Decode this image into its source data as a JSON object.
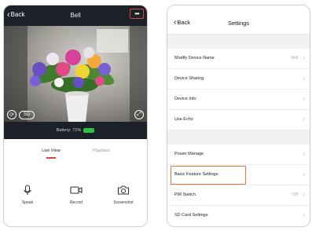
{
  "left_screen": {
    "back_label": "Back",
    "title": "Bell",
    "more_label": "•••",
    "sd_label": "SD",
    "battery_label": "Battery: 71%",
    "tabs": [
      {
        "label": "Live View"
      },
      {
        "label": "Playback"
      }
    ],
    "actions": [
      {
        "label": "Speak",
        "icon": "microphone-icon"
      },
      {
        "label": "Record",
        "icon": "video-camera-icon"
      },
      {
        "label": "Screenshot",
        "icon": "camera-icon"
      }
    ],
    "battery_level": 0.71,
    "colors": {
      "header_bg": "#1c2029",
      "accent": "#d9452f",
      "battery": "#2ec24a"
    }
  },
  "right_screen": {
    "back_label": "Back",
    "title": "Settings",
    "groups": [
      {
        "items": [
          {
            "label": "Modify Device Name",
            "value": "Bell"
          },
          {
            "label": "Device Sharing",
            "value": ""
          },
          {
            "label": "Device Info",
            "value": ""
          },
          {
            "label": "Use Echo",
            "value": ""
          }
        ]
      },
      {
        "items": [
          {
            "label": "Power Manage",
            "value": ""
          },
          {
            "label": "Basic Feature Settings",
            "value": "",
            "highlighted": true
          },
          {
            "label": "PIR Switch",
            "value": "Off"
          },
          {
            "label": "SD Card Settings",
            "value": ""
          }
        ]
      }
    ],
    "colors": {
      "highlight_border": "#e0743f",
      "group_gap": "#f1f1f3"
    }
  }
}
